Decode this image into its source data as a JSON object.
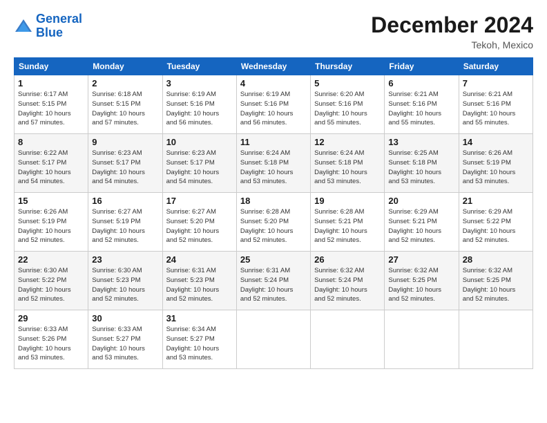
{
  "header": {
    "logo_line1": "General",
    "logo_line2": "Blue",
    "main_title": "December 2024",
    "subtitle": "Tekoh, Mexico"
  },
  "days_of_week": [
    "Sunday",
    "Monday",
    "Tuesday",
    "Wednesday",
    "Thursday",
    "Friday",
    "Saturday"
  ],
  "weeks": [
    [
      {
        "date": "1",
        "info": "Sunrise: 6:17 AM\nSunset: 5:15 PM\nDaylight: 10 hours\nand 57 minutes."
      },
      {
        "date": "2",
        "info": "Sunrise: 6:18 AM\nSunset: 5:15 PM\nDaylight: 10 hours\nand 57 minutes."
      },
      {
        "date": "3",
        "info": "Sunrise: 6:19 AM\nSunset: 5:16 PM\nDaylight: 10 hours\nand 56 minutes."
      },
      {
        "date": "4",
        "info": "Sunrise: 6:19 AM\nSunset: 5:16 PM\nDaylight: 10 hours\nand 56 minutes."
      },
      {
        "date": "5",
        "info": "Sunrise: 6:20 AM\nSunset: 5:16 PM\nDaylight: 10 hours\nand 55 minutes."
      },
      {
        "date": "6",
        "info": "Sunrise: 6:21 AM\nSunset: 5:16 PM\nDaylight: 10 hours\nand 55 minutes."
      },
      {
        "date": "7",
        "info": "Sunrise: 6:21 AM\nSunset: 5:16 PM\nDaylight: 10 hours\nand 55 minutes."
      }
    ],
    [
      {
        "date": "8",
        "info": "Sunrise: 6:22 AM\nSunset: 5:17 PM\nDaylight: 10 hours\nand 54 minutes."
      },
      {
        "date": "9",
        "info": "Sunrise: 6:23 AM\nSunset: 5:17 PM\nDaylight: 10 hours\nand 54 minutes."
      },
      {
        "date": "10",
        "info": "Sunrise: 6:23 AM\nSunset: 5:17 PM\nDaylight: 10 hours\nand 54 minutes."
      },
      {
        "date": "11",
        "info": "Sunrise: 6:24 AM\nSunset: 5:18 PM\nDaylight: 10 hours\nand 53 minutes."
      },
      {
        "date": "12",
        "info": "Sunrise: 6:24 AM\nSunset: 5:18 PM\nDaylight: 10 hours\nand 53 minutes."
      },
      {
        "date": "13",
        "info": "Sunrise: 6:25 AM\nSunset: 5:18 PM\nDaylight: 10 hours\nand 53 minutes."
      },
      {
        "date": "14",
        "info": "Sunrise: 6:26 AM\nSunset: 5:19 PM\nDaylight: 10 hours\nand 53 minutes."
      }
    ],
    [
      {
        "date": "15",
        "info": "Sunrise: 6:26 AM\nSunset: 5:19 PM\nDaylight: 10 hours\nand 52 minutes."
      },
      {
        "date": "16",
        "info": "Sunrise: 6:27 AM\nSunset: 5:19 PM\nDaylight: 10 hours\nand 52 minutes."
      },
      {
        "date": "17",
        "info": "Sunrise: 6:27 AM\nSunset: 5:20 PM\nDaylight: 10 hours\nand 52 minutes."
      },
      {
        "date": "18",
        "info": "Sunrise: 6:28 AM\nSunset: 5:20 PM\nDaylight: 10 hours\nand 52 minutes."
      },
      {
        "date": "19",
        "info": "Sunrise: 6:28 AM\nSunset: 5:21 PM\nDaylight: 10 hours\nand 52 minutes."
      },
      {
        "date": "20",
        "info": "Sunrise: 6:29 AM\nSunset: 5:21 PM\nDaylight: 10 hours\nand 52 minutes."
      },
      {
        "date": "21",
        "info": "Sunrise: 6:29 AM\nSunset: 5:22 PM\nDaylight: 10 hours\nand 52 minutes."
      }
    ],
    [
      {
        "date": "22",
        "info": "Sunrise: 6:30 AM\nSunset: 5:22 PM\nDaylight: 10 hours\nand 52 minutes."
      },
      {
        "date": "23",
        "info": "Sunrise: 6:30 AM\nSunset: 5:23 PM\nDaylight: 10 hours\nand 52 minutes."
      },
      {
        "date": "24",
        "info": "Sunrise: 6:31 AM\nSunset: 5:23 PM\nDaylight: 10 hours\nand 52 minutes."
      },
      {
        "date": "25",
        "info": "Sunrise: 6:31 AM\nSunset: 5:24 PM\nDaylight: 10 hours\nand 52 minutes."
      },
      {
        "date": "26",
        "info": "Sunrise: 6:32 AM\nSunset: 5:24 PM\nDaylight: 10 hours\nand 52 minutes."
      },
      {
        "date": "27",
        "info": "Sunrise: 6:32 AM\nSunset: 5:25 PM\nDaylight: 10 hours\nand 52 minutes."
      },
      {
        "date": "28",
        "info": "Sunrise: 6:32 AM\nSunset: 5:25 PM\nDaylight: 10 hours\nand 52 minutes."
      }
    ],
    [
      {
        "date": "29",
        "info": "Sunrise: 6:33 AM\nSunset: 5:26 PM\nDaylight: 10 hours\nand 53 minutes."
      },
      {
        "date": "30",
        "info": "Sunrise: 6:33 AM\nSunset: 5:27 PM\nDaylight: 10 hours\nand 53 minutes."
      },
      {
        "date": "31",
        "info": "Sunrise: 6:34 AM\nSunset: 5:27 PM\nDaylight: 10 hours\nand 53 minutes."
      },
      null,
      null,
      null,
      null
    ]
  ]
}
